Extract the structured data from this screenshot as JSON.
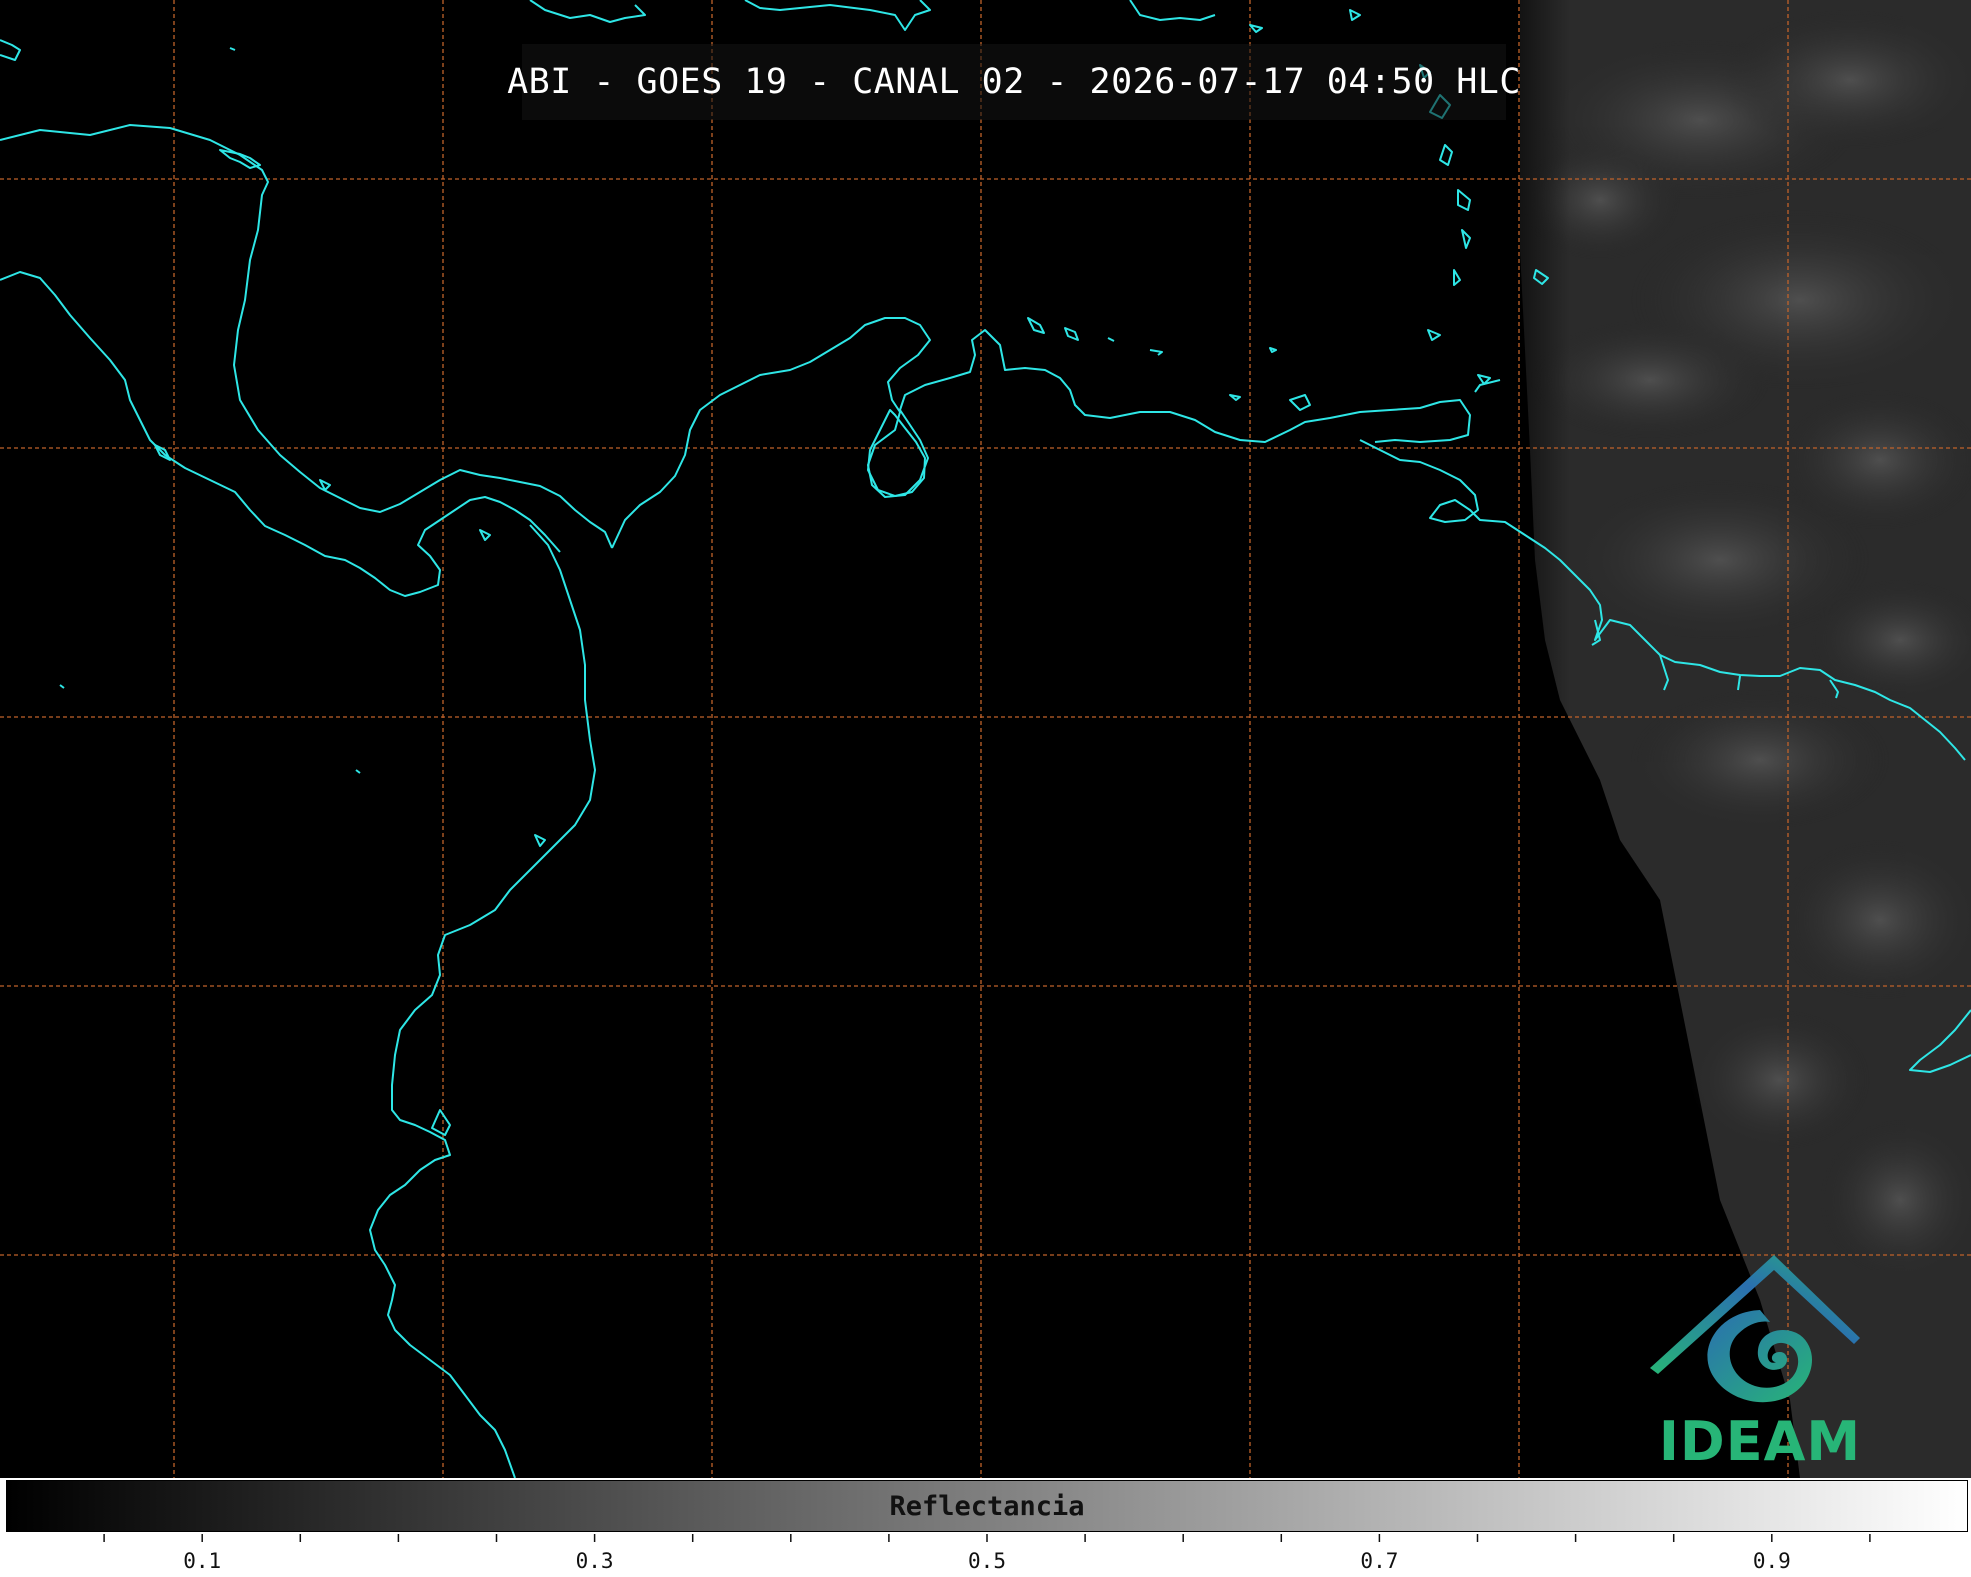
{
  "title": "ABI - GOES 19 - CANAL 02 - 2026-07-17 04:50 HLC",
  "logo": {
    "text": "IDEAM",
    "icon": "ideam-logo-icon"
  },
  "colorbar": {
    "label": "Reflectancia",
    "range": [
      0,
      1
    ],
    "tick_labels": [
      "0.1",
      "0.3",
      "0.5",
      "0.7",
      "0.9"
    ],
    "tick_values": [
      0.1,
      0.3,
      0.5,
      0.7,
      0.9
    ]
  },
  "colors": {
    "coastline": "#2ee6e6",
    "gridline": "#c0622a",
    "background": "#000000",
    "logo_green": "#27b577",
    "logo_blue": "#2a6fb0"
  }
}
